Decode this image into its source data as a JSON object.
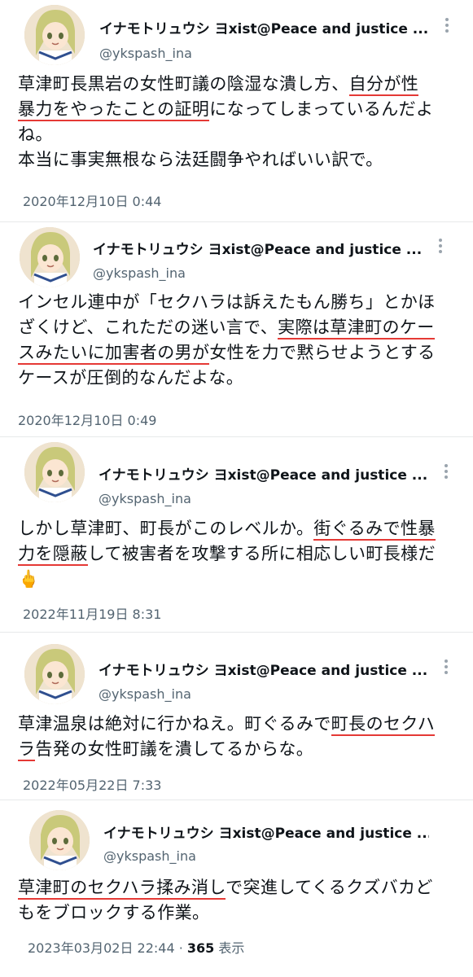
{
  "account": {
    "display_name": "イナモトリュウシ ヨxist@Peace and justice ...",
    "handle": "@ykspash_ina"
  },
  "tweets": [
    {
      "lines": [
        [
          {
            "t": "草津町長黒岩の女性町議の陰湿な潰し方、"
          },
          {
            "t": "自分が性",
            "u": true
          }
        ],
        [
          {
            "t": "暴力をやったことの証明",
            "u": true
          },
          {
            "t": "になってしまっているんだよ"
          }
        ],
        [
          {
            "t": "ね。"
          }
        ],
        [
          {
            "t": "本当に事実無根なら法廷闘争やればいい訳で。"
          }
        ]
      ],
      "timestamp": "2020年12月10日 0:44"
    },
    {
      "lines": [
        [
          {
            "t": "インセル連中が「セクハラは訴えたもん勝ち」とかほ"
          }
        ],
        [
          {
            "t": "ざくけど、これただの迷い言で、"
          },
          {
            "t": "実際は草津町のケー",
            "u": true
          }
        ],
        [
          {
            "t": "スみたいに加害者の男が",
            "u": true
          },
          {
            "t": "女性を力で黙らせようとする"
          }
        ],
        [
          {
            "t": "ケースが圧倒的なんだよな。"
          }
        ]
      ],
      "timestamp": "2020年12月10日 0:49"
    },
    {
      "lines": [
        [
          {
            "t": "しかし草津町、町長がこのレベルか。"
          },
          {
            "t": "街ぐるみで性暴",
            "u": true
          }
        ],
        [
          {
            "t": "力を隠蔽",
            "u": true
          },
          {
            "t": "して被害者を攻撃する所に相応しい町長様だ"
          }
        ],
        [
          {
            "t": "🖕",
            "emoji": true
          }
        ]
      ],
      "timestamp": "2022年11月19日 8:31"
    },
    {
      "lines": [
        [
          {
            "t": "草津温泉は絶対に行かねえ。町ぐるみで"
          },
          {
            "t": "町長のセクハ",
            "u": true
          }
        ],
        [
          {
            "t": "ラ",
            "u": true
          },
          {
            "t": "告発の女性町議を潰してるからな。"
          }
        ]
      ],
      "timestamp": "2022年05月22日 7:33"
    },
    {
      "lines": [
        [
          {
            "t": "草津町のセクハラ揉み消し",
            "u": true
          },
          {
            "t": "で突進してくるクズバカど"
          }
        ],
        [
          {
            "t": "もをブロックする作業。"
          }
        ]
      ],
      "timestamp": "2023年03月02日 22:44 · ",
      "views_count": "365",
      "views_label": " 表示"
    }
  ]
}
